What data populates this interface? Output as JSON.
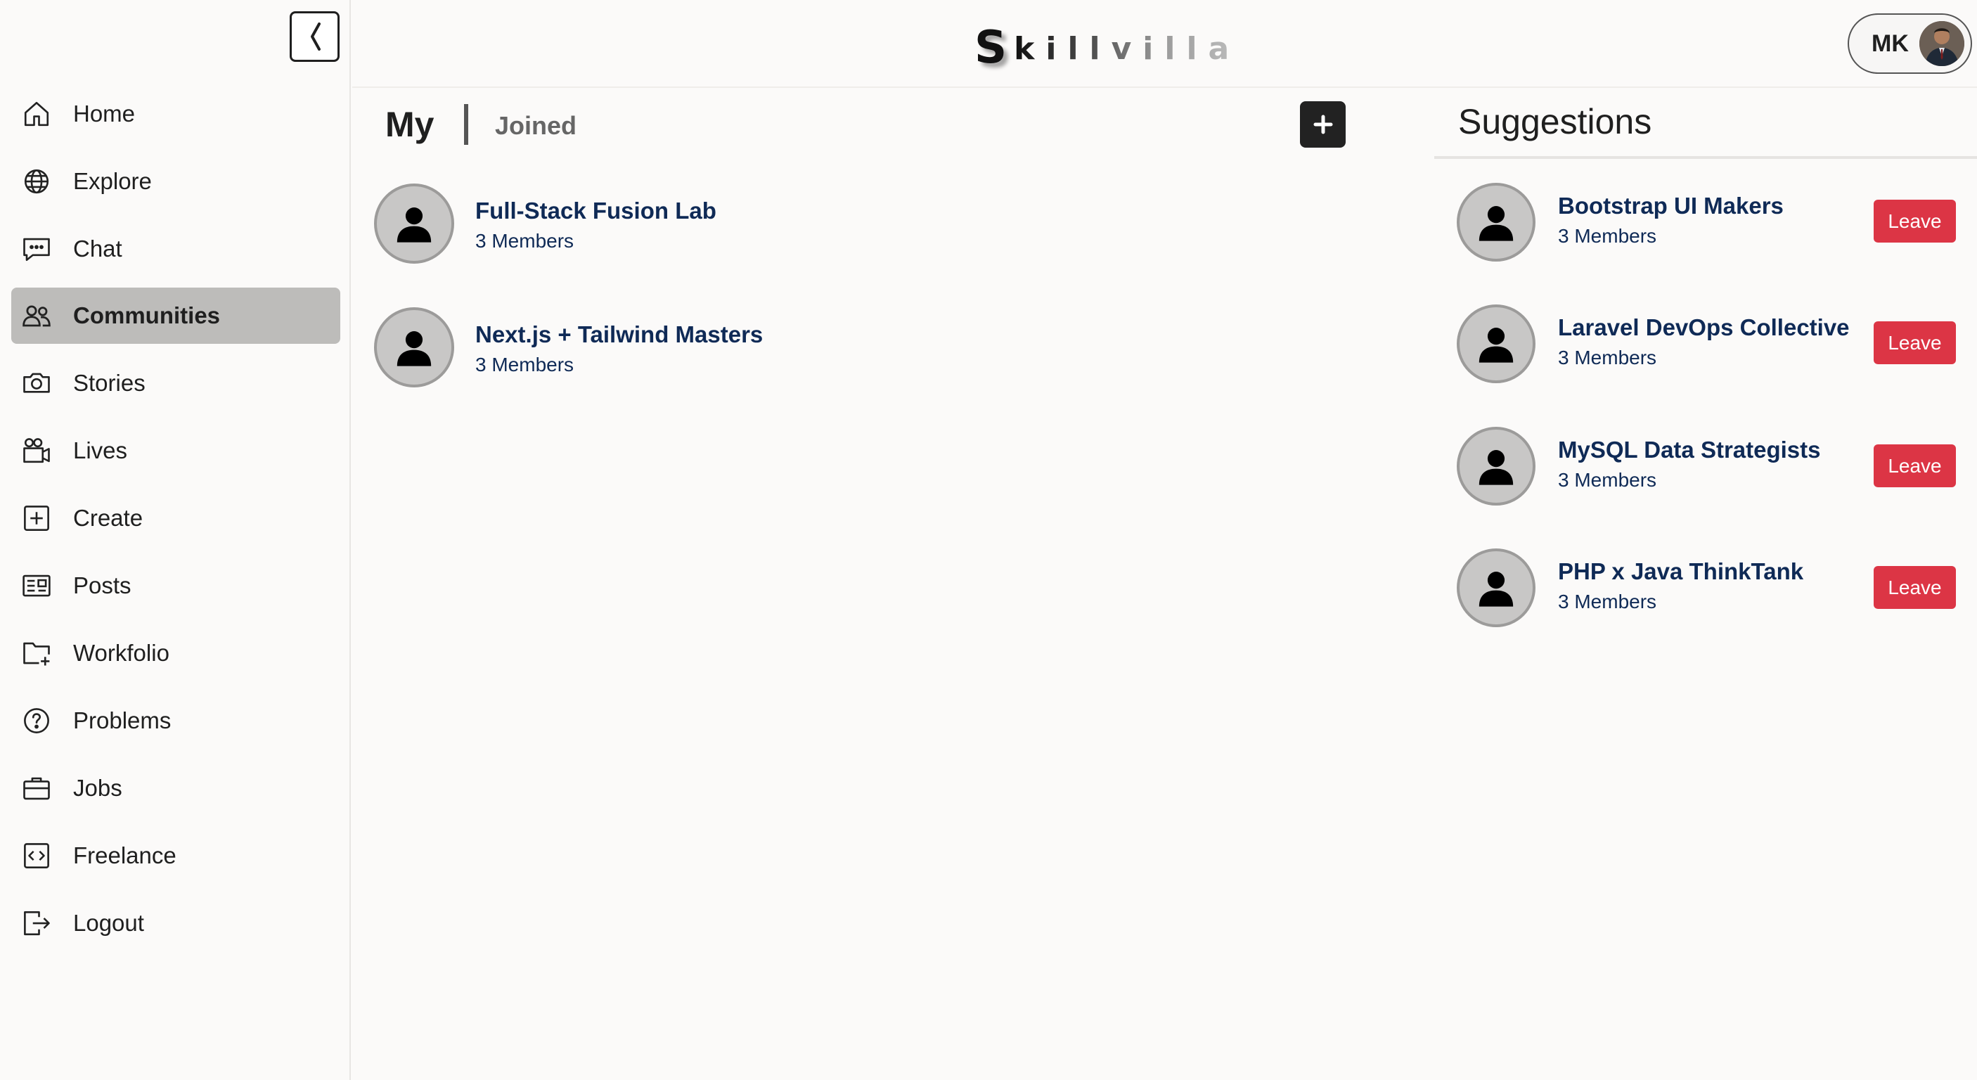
{
  "sidebar": {
    "collapse_label": "❬",
    "items": [
      {
        "label": "Home",
        "icon": "home-icon"
      },
      {
        "label": "Explore",
        "icon": "globe-icon"
      },
      {
        "label": "Chat",
        "icon": "chat-icon"
      },
      {
        "label": "Communities",
        "icon": "people-icon",
        "active": true
      },
      {
        "label": "Stories",
        "icon": "camera-icon"
      },
      {
        "label": "Lives",
        "icon": "video-camera-icon"
      },
      {
        "label": "Create",
        "icon": "plus-square-icon"
      },
      {
        "label": "Posts",
        "icon": "newspaper-icon"
      },
      {
        "label": "Workfolio",
        "icon": "folder-plus-icon"
      },
      {
        "label": "Problems",
        "icon": "question-circle-icon"
      },
      {
        "label": "Jobs",
        "icon": "briefcase-icon"
      },
      {
        "label": "Freelance",
        "icon": "code-square-icon"
      },
      {
        "label": "Logout",
        "icon": "logout-icon"
      }
    ],
    "active_background": "#bdbcba"
  },
  "header": {
    "logo_first": "S",
    "logo_rest": "killvilla",
    "user_initials": "MK"
  },
  "main": {
    "tab_my": "My",
    "tab_joined": "Joined",
    "add_icon": "plus-icon",
    "groups": [
      {
        "name": "Full-Stack Fusion Lab",
        "members": "3 Members"
      },
      {
        "name": "Next.js + Tailwind Masters",
        "members": "3 Members"
      }
    ]
  },
  "suggestions": {
    "title": "Suggestions",
    "items": [
      {
        "name": "Bootstrap UI Makers",
        "members": "3 Members",
        "action": "Leave"
      },
      {
        "name": "Laravel DevOps Collective",
        "members": "3 Members",
        "action": "Leave"
      },
      {
        "name": "MySQL Data Strategists",
        "members": "3 Members",
        "action": "Leave"
      },
      {
        "name": "PHP x Java ThinkTank",
        "members": "3 Members",
        "action": "Leave"
      }
    ]
  },
  "colors": {
    "page_bg": "#fbfaf9",
    "link_text": "#0f2a56",
    "leave_button": "#dc3545",
    "add_button": "#222222"
  }
}
